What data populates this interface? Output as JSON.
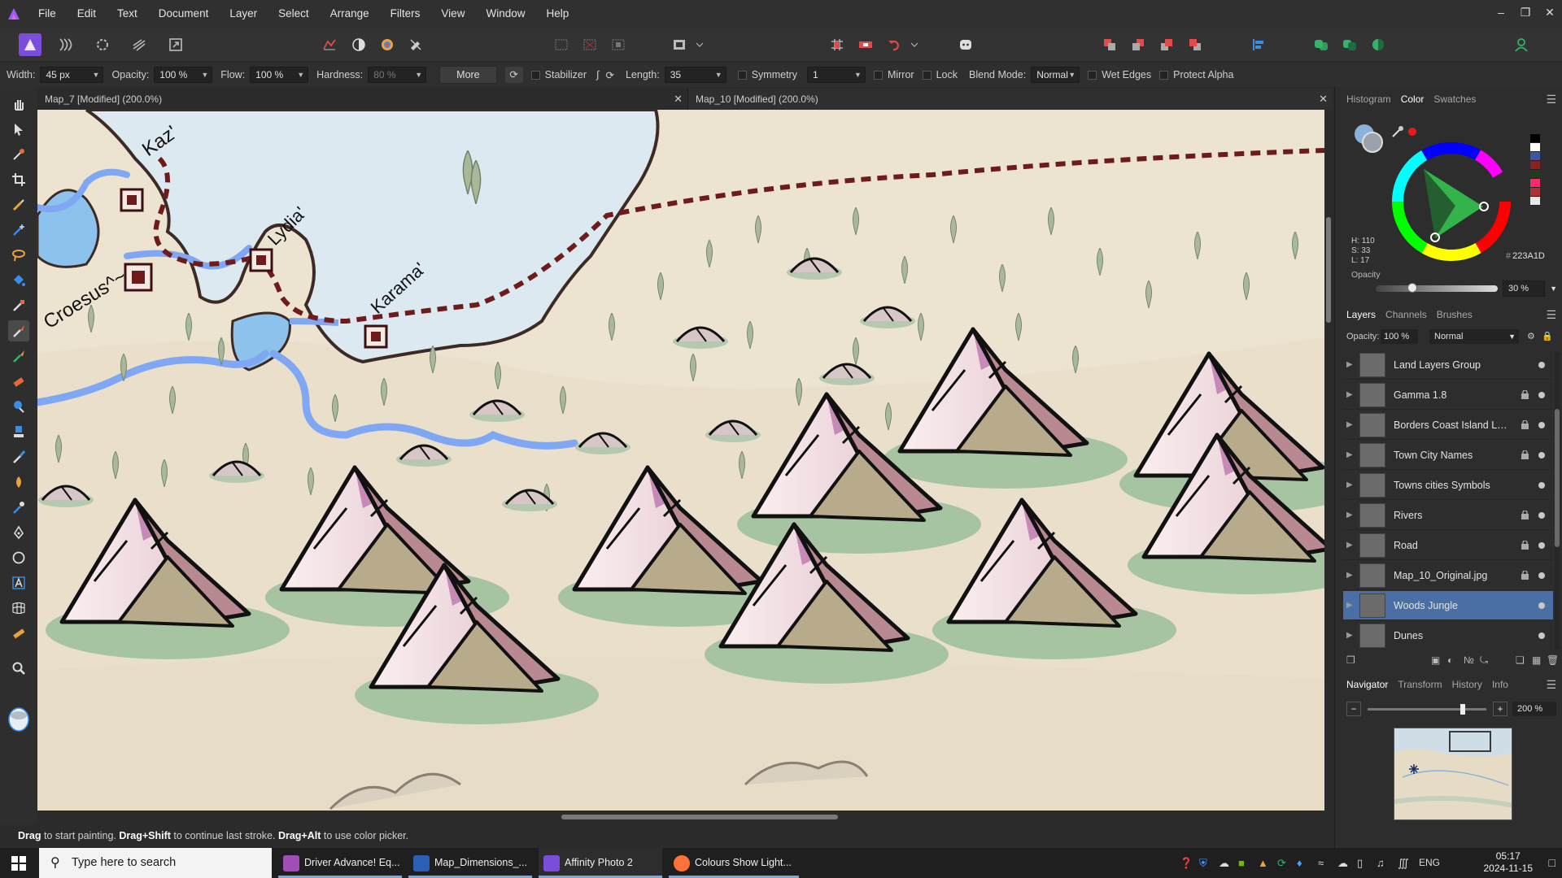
{
  "menu": [
    "File",
    "Edit",
    "Text",
    "Document",
    "Layer",
    "Select",
    "Arrange",
    "Filters",
    "View",
    "Window",
    "Help"
  ],
  "context": {
    "width_label": "Width:",
    "width_value": "45 px",
    "opacity_label": "Opacity:",
    "opacity_value": "100 %",
    "flow_label": "Flow:",
    "flow_value": "100 %",
    "hardness_label": "Hardness:",
    "hardness_value": "80 %",
    "more_label": "More",
    "stabilizer_label": "Stabilizer",
    "length_label": "Length:",
    "length_value": "35",
    "symmetry_label": "Symmetry",
    "symmetry_value": "1",
    "mirror_label": "Mirror",
    "lock_label": "Lock",
    "blend_label": "Blend Mode:",
    "blend_value": "Normal",
    "wet_edges_label": "Wet Edges",
    "protect_alpha_label": "Protect Alpha"
  },
  "documents": [
    {
      "title": "Map_7 [Modified] (200.0%)"
    },
    {
      "title": "Map_10 [Modified] (200.0%)"
    }
  ],
  "map_labels": [
    "Kaz'",
    "Lydia'",
    "Karama'",
    "Croesus^~"
  ],
  "status": {
    "drag": "Drag",
    "t1": " to start painting. ",
    "drag_shift": "Drag+Shift",
    "t2": " to continue last stroke. ",
    "drag_alt": "Drag+Alt",
    "t3": " to use color picker."
  },
  "color_panel": {
    "tabs": [
      "Histogram",
      "Color",
      "Swatches"
    ],
    "active_tab": "Color",
    "hsl": [
      "H: 110",
      "S: 33",
      "L: 17"
    ],
    "hex": "223A1D",
    "opacity_label": "Opacity",
    "opacity_value": "30 %",
    "opacity_fraction": 0.3,
    "current_color": "#223A1D",
    "swatches": [
      "#000000",
      "#ffffff",
      "#3a5a9a",
      "#8a2020",
      "#223A1D",
      "#ff2a6d",
      "#b03030",
      "#e8e8e8"
    ]
  },
  "layers_panel": {
    "tabs": [
      "Layers",
      "Channels",
      "Brushes"
    ],
    "active_tab": "Layers",
    "opacity_label": "Opacity:",
    "opacity_value": "100 %",
    "blend_value": "Normal",
    "layers": [
      {
        "name": "Land Layers Group",
        "locked": false
      },
      {
        "name": "Gamma 1.8",
        "locked": true
      },
      {
        "name": "Borders Coast Island La...",
        "locked": true
      },
      {
        "name": "Town City Names",
        "locked": true
      },
      {
        "name": "Towns cities Symbols",
        "locked": false
      },
      {
        "name": "Rivers",
        "locked": true
      },
      {
        "name": "Road",
        "locked": true
      },
      {
        "name": "Map_10_Original.jpg",
        "locked": true
      },
      {
        "name": "Woods Jungle",
        "locked": false,
        "selected": true
      },
      {
        "name": "Dunes",
        "locked": false
      }
    ]
  },
  "navigator_panel": {
    "tabs": [
      "Navigator",
      "Transform",
      "History",
      "Info"
    ],
    "active_tab": "Navigator",
    "zoom_value": "200 %",
    "zoom_fraction": 0.8
  },
  "taskbar": {
    "search_placeholder": "Type here to search",
    "apps": [
      "Driver Advance! Eq...",
      "Map_Dimensions_...",
      "Affinity Photo 2",
      "Colours Show Light..."
    ],
    "lang": "ENG",
    "time": "05:17",
    "date": "2024-11-15"
  }
}
